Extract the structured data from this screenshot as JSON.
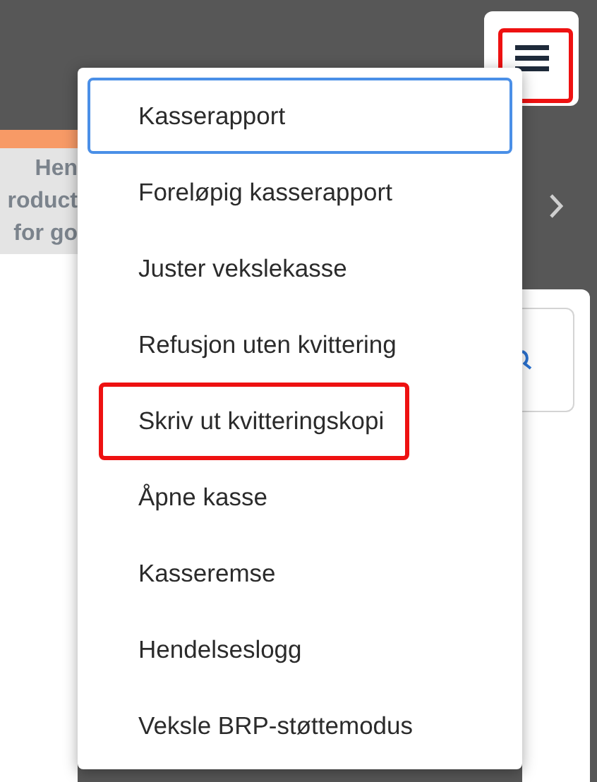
{
  "menu_button": {
    "highlighted": true
  },
  "side_panel": {
    "lines": [
      "Hen",
      "roduct",
      "for go"
    ]
  },
  "menu": {
    "items": [
      {
        "label": "Kasserapport",
        "focused": true,
        "highlighted": false
      },
      {
        "label": "Foreløpig kasserapport",
        "focused": false,
        "highlighted": false
      },
      {
        "label": "Juster vekslekasse",
        "focused": false,
        "highlighted": false
      },
      {
        "label": "Refusjon uten kvittering",
        "focused": false,
        "highlighted": false
      },
      {
        "label": "Skriv ut kvitteringskopi",
        "focused": false,
        "highlighted": true
      },
      {
        "label": "Åpne kasse",
        "focused": false,
        "highlighted": false
      },
      {
        "label": "Kasseremse",
        "focused": false,
        "highlighted": false
      },
      {
        "label": "Hendelseslogg",
        "focused": false,
        "highlighted": false
      },
      {
        "label": "Veksle BRP-støttemodus",
        "focused": false,
        "highlighted": false
      }
    ]
  }
}
